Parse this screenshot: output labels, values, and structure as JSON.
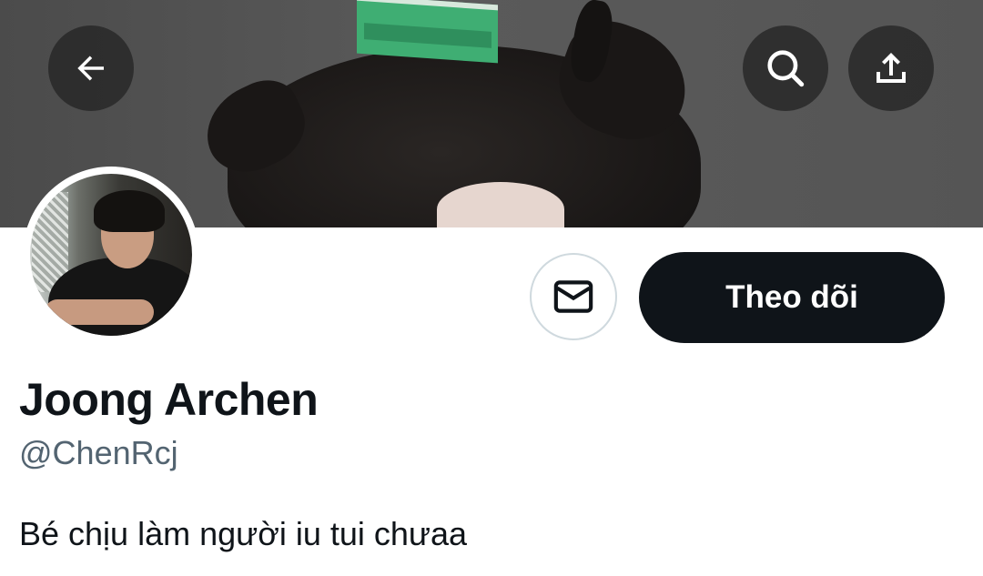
{
  "header": {
    "back_icon": "arrow-left-icon",
    "search_icon": "search-icon",
    "share_icon": "share-upload-icon",
    "button_bg": "#2a2a2a"
  },
  "profile": {
    "display_name": "Joong Archen",
    "handle": "@ChenRcj",
    "bio": "Bé chịu làm người iu tui chưaa"
  },
  "actions": {
    "message_icon": "envelope-icon",
    "follow_label": "Theo dõi"
  },
  "colors": {
    "text_primary": "#0f1419",
    "text_secondary": "#536471",
    "follow_button_bg": "#0f1419",
    "border": "#cfd9de"
  }
}
